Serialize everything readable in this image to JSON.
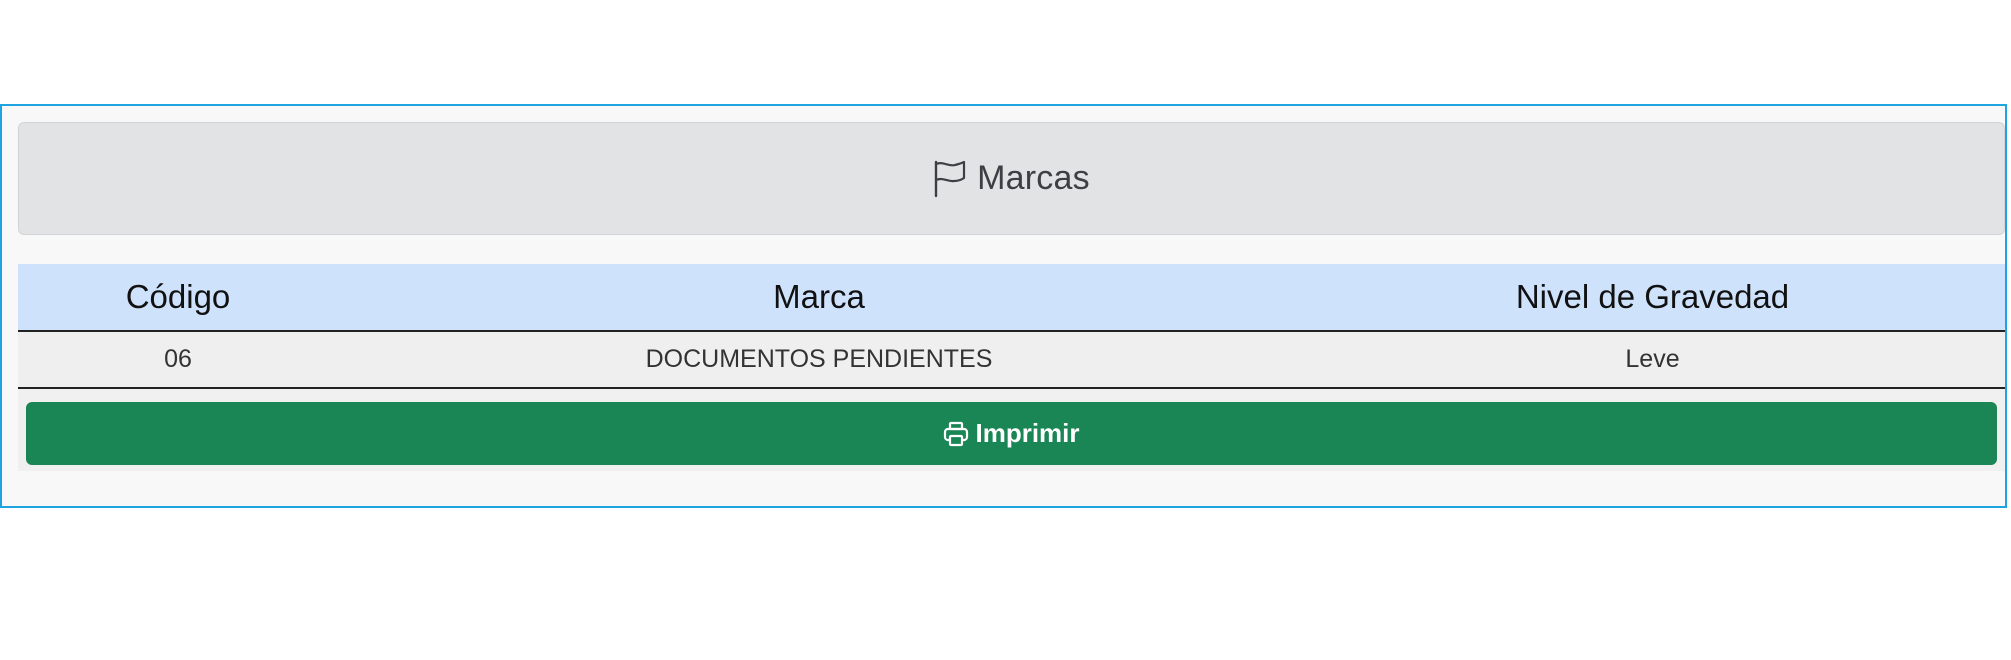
{
  "header": {
    "title": "Marcas",
    "icon": "flag-icon"
  },
  "table": {
    "columns": [
      "Código",
      "Marca",
      "Nivel de Gravedad"
    ],
    "rows": [
      [
        "06",
        "DOCUMENTOS PENDIENTES",
        "Leve"
      ]
    ]
  },
  "actions": {
    "print_label": "Imprimir",
    "print_icon": "printer-icon"
  },
  "colors": {
    "frame_border": "#1ea4e0",
    "header_bg": "#e2e3e5",
    "table_head_bg": "#cfe2fc",
    "print_button_bg": "#1b8655"
  }
}
